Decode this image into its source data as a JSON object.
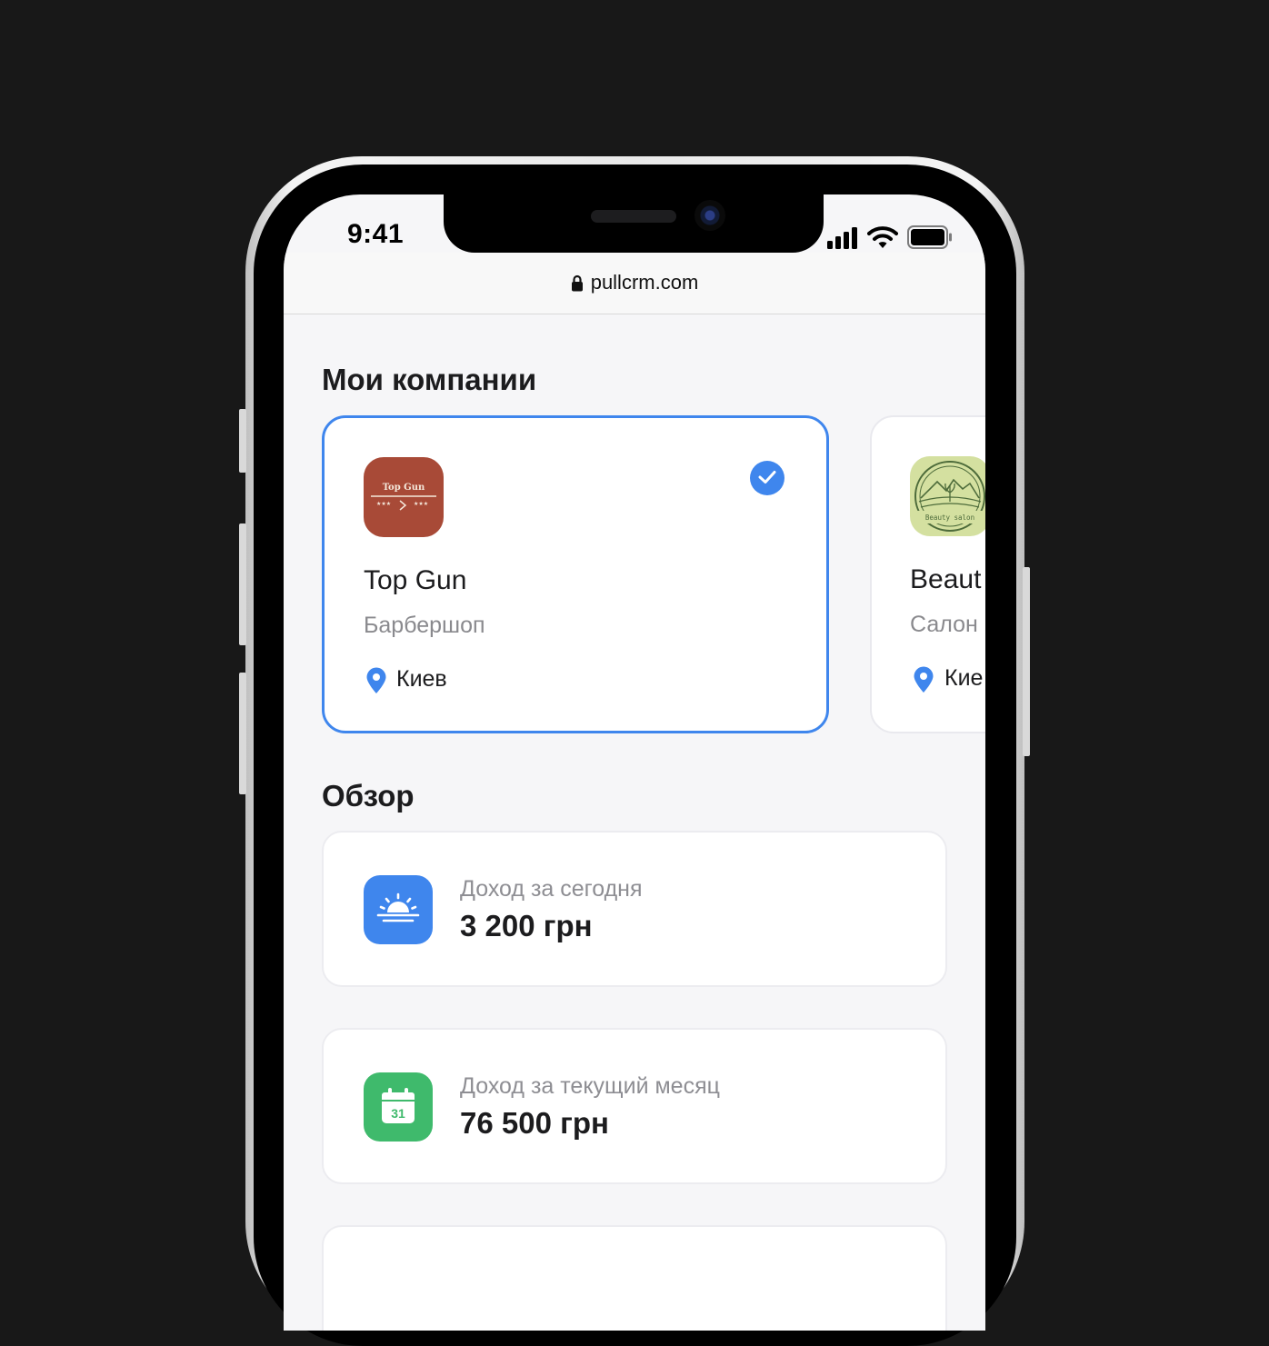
{
  "status_bar": {
    "time": "9:41"
  },
  "browser": {
    "url": "pullcrm.com"
  },
  "companies_section": {
    "title": "Мои компании",
    "companies": [
      {
        "logo_text": "Top Gun",
        "name": "Top Gun",
        "type": "Барбершоп",
        "city": "Киев",
        "selected": true,
        "logo_color": "#a84a37"
      },
      {
        "logo_text": "Beauty salon",
        "name": "Beaut",
        "type": "Салон",
        "city": "Кие",
        "selected": false,
        "logo_color": "#d4e0a0"
      }
    ]
  },
  "overview_section": {
    "title": "Обзор",
    "stats": [
      {
        "label": "Доход за сегодня",
        "value": "3 200 грн",
        "icon": "sunrise-icon",
        "icon_color": "#3f86ed"
      },
      {
        "label": "Доход за текущий месяц",
        "value": "76 500 грн",
        "icon": "calendar-icon",
        "icon_text": "31",
        "icon_color": "#3fba6c"
      }
    ]
  },
  "colors": {
    "accent": "#3f86ed",
    "success": "#3fba6c",
    "background": "#181818"
  }
}
